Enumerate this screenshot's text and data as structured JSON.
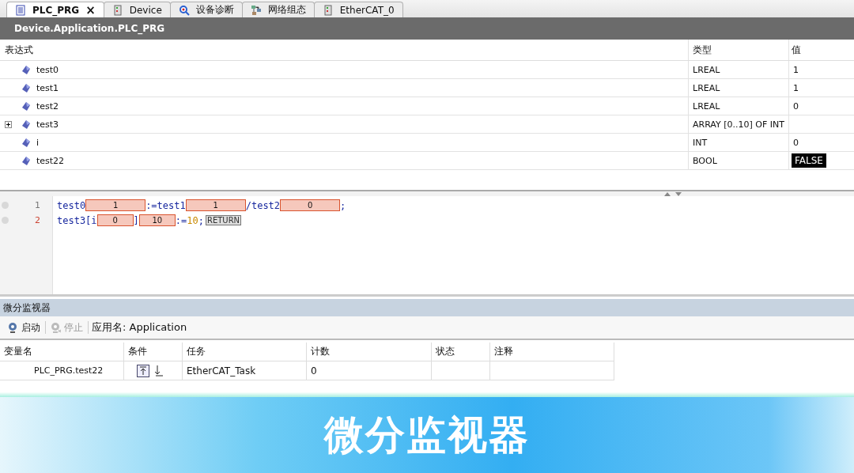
{
  "tabs": [
    {
      "label": "PLC_PRG",
      "kind": "document",
      "selected": true,
      "closable": true
    },
    {
      "label": "Device",
      "kind": "device",
      "selected": false,
      "closable": false
    },
    {
      "label": "设备诊断",
      "kind": "diagnosis",
      "selected": false,
      "closable": false
    },
    {
      "label": "网络组态",
      "kind": "network",
      "selected": false,
      "closable": false
    },
    {
      "label": "EtherCAT_0",
      "kind": "device",
      "selected": false,
      "closable": false
    }
  ],
  "close_glyph": "×",
  "path_bar": "Device.Application.PLC_PRG",
  "watch": {
    "columns": [
      "表达式",
      "类型",
      "值"
    ],
    "rows": [
      {
        "expression": "test0",
        "type": "LREAL",
        "value": "1",
        "expandable": false,
        "highlighted": false
      },
      {
        "expression": "test1",
        "type": "LREAL",
        "value": "1",
        "expandable": false,
        "highlighted": false
      },
      {
        "expression": "test2",
        "type": "LREAL",
        "value": "0",
        "expandable": false,
        "highlighted": false
      },
      {
        "expression": "test3",
        "type": "ARRAY [0..10] OF INT",
        "expandable": true
      },
      {
        "expression": "i",
        "type": "INT",
        "value": "0",
        "expandable": false,
        "highlighted": false
      },
      {
        "expression": "test22",
        "type": "BOOL",
        "value": "FALSE",
        "expandable": false,
        "highlighted": true
      }
    ]
  },
  "code": {
    "lines": [
      {
        "number": "1",
        "current": false,
        "tokens": [
          {
            "kind": "code",
            "text": "test0"
          },
          {
            "kind": "value",
            "text": "1"
          },
          {
            "kind": "code",
            "text": ":=test1"
          },
          {
            "kind": "value",
            "text": "1"
          },
          {
            "kind": "code",
            "text": "/test2"
          },
          {
            "kind": "value",
            "text": "0"
          },
          {
            "kind": "code",
            "text": ";"
          }
        ]
      },
      {
        "number": "2",
        "current": true,
        "tokens": [
          {
            "kind": "code",
            "text": "test3[i"
          },
          {
            "kind": "value",
            "text": "0",
            "short": true
          },
          {
            "kind": "code",
            "text": "]"
          },
          {
            "kind": "value",
            "text": "10",
            "short": true
          },
          {
            "kind": "code",
            "text": ":="
          },
          {
            "kind": "number",
            "text": "10"
          },
          {
            "kind": "code",
            "text": ";"
          },
          {
            "kind": "badge",
            "text": "RETURN"
          }
        ]
      }
    ]
  },
  "monitor": {
    "title": "微分监视器",
    "toolbar": [
      {
        "kind": "start",
        "label": "启动",
        "disabled": false
      },
      {
        "kind": "stop",
        "label": "停止",
        "disabled": true
      }
    ],
    "app_label": "应用名: Application",
    "columns": [
      "变量名",
      "条件",
      "任务",
      "计数",
      "状态",
      "注释"
    ],
    "rows": [
      {
        "variable": "PLC_PRG.test22",
        "task": "EtherCAT_Task",
        "count": "0"
      }
    ]
  },
  "banner": {
    "title": "微分监视器"
  }
}
